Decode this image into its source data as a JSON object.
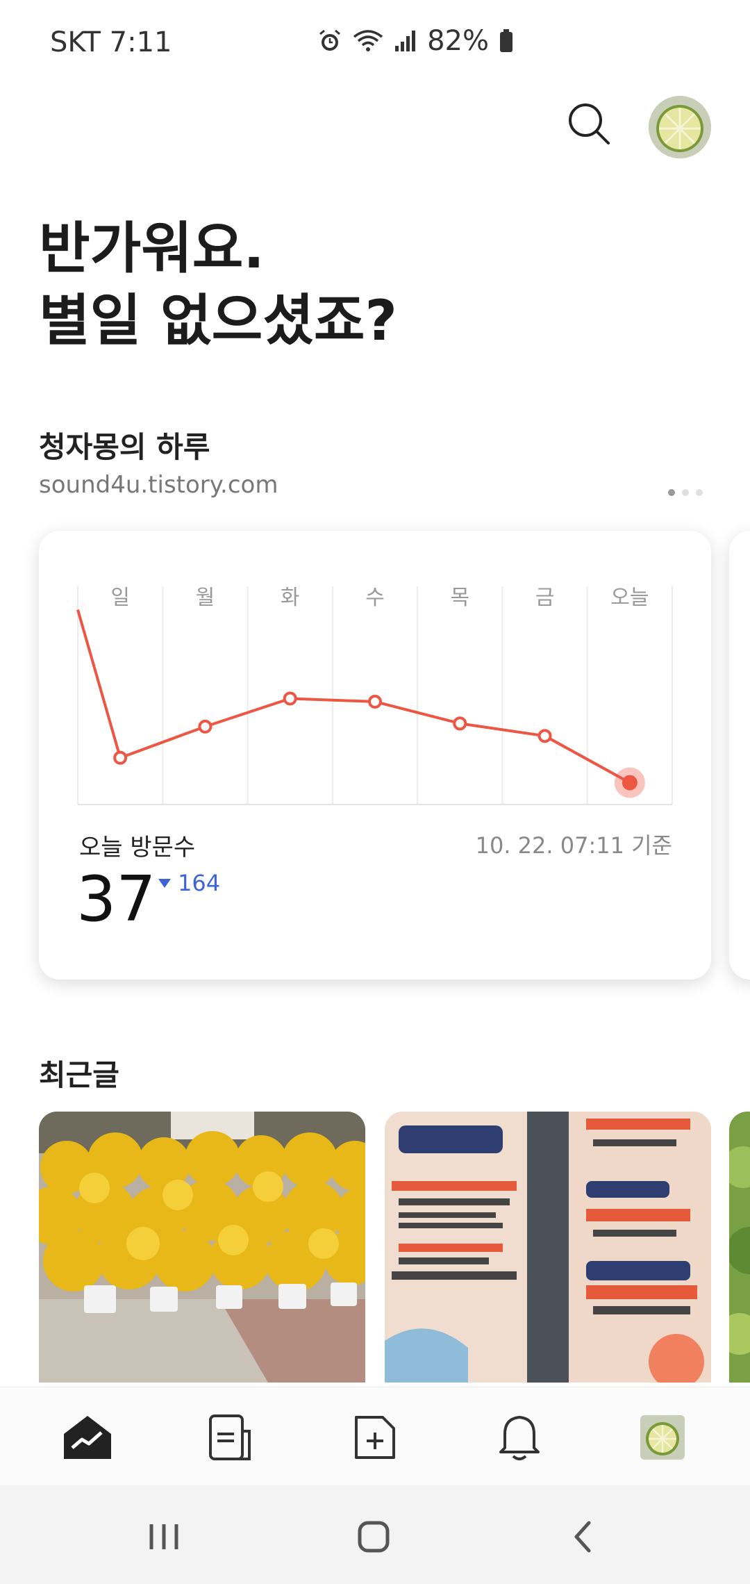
{
  "status_bar": {
    "carrier_time": "SKT 7:11",
    "battery": "82%"
  },
  "header": {
    "search_icon": "search-icon",
    "avatar_icon": "lime-profile-avatar"
  },
  "greeting": {
    "line1": "반가워요.",
    "line2": "별일 없으셨죠?"
  },
  "blog": {
    "name": "청자몽의 하루",
    "url": "sound4u.tistory.com"
  },
  "stats": {
    "visit_label": "오늘 방문수",
    "visit_count": "37",
    "visit_diff": "164",
    "timestamp": "10. 22. 07:11 기준",
    "line_color": "#ee5644",
    "diff_color": "#3c64d8"
  },
  "chart_data": {
    "type": "line",
    "categories": [
      "일",
      "월",
      "화",
      "수",
      "목",
      "금",
      "오늘"
    ],
    "series": [
      {
        "values": [
          230,
          250,
          268,
          266,
          252,
          244,
          214
        ]
      }
    ],
    "start_value": 325,
    "ylim": [
      200,
      340
    ],
    "grid": "vertical"
  },
  "recent": {
    "title": "최근글"
  },
  "bottom_nav": {
    "items": [
      "stats-icon",
      "posts-icon",
      "new-post-icon",
      "notifications-icon",
      "profile-icon"
    ]
  },
  "system_nav": {
    "items": [
      "recent-apps-icon",
      "home-icon",
      "back-icon"
    ]
  }
}
